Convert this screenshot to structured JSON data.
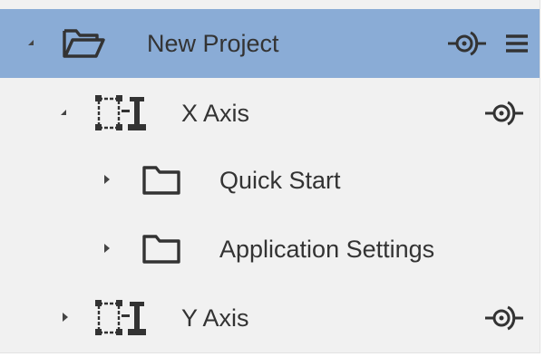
{
  "colors": {
    "panel_bg": "#f1f1f1",
    "selected_bg": "#8aacd6",
    "text": "#333333",
    "icon": "#333333"
  },
  "tree": {
    "rows": [
      {
        "label": "New Project",
        "level": 0,
        "expanded": true,
        "icon": "folder-open-icon",
        "actions": [
          "connector-icon",
          "menu-icon"
        ],
        "selected": true
      },
      {
        "label": "X Axis",
        "level": 1,
        "expanded": true,
        "icon": "axis-grid-icon",
        "actions": [
          "connector-icon"
        ],
        "selected": false
      },
      {
        "label": "Quick Start",
        "level": 2,
        "expanded": false,
        "icon": "folder-icon",
        "actions": [],
        "selected": false
      },
      {
        "label": "Application Settings",
        "level": 2,
        "expanded": false,
        "icon": "folder-icon",
        "actions": [],
        "selected": false
      },
      {
        "label": "Y Axis",
        "level": 1,
        "expanded": false,
        "icon": "axis-grid-icon",
        "actions": [
          "connector-icon"
        ],
        "selected": false
      }
    ]
  }
}
